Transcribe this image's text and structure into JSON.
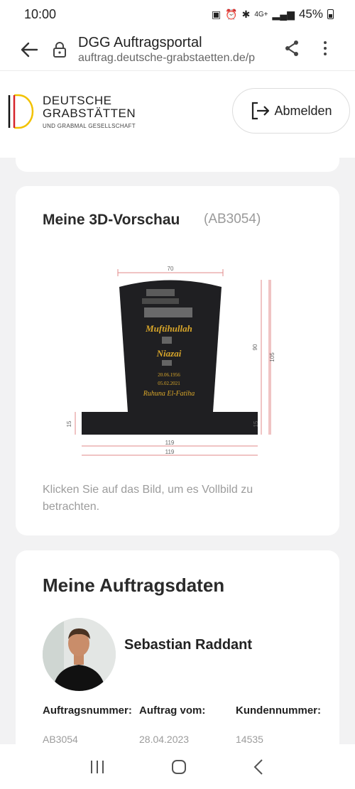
{
  "status": {
    "time": "10:00",
    "battery": "45%",
    "network": "4G+"
  },
  "browser": {
    "title": "DGG Auftragsportal",
    "url": "auftrag.deutsche-grabstaetten.de/p"
  },
  "brand": {
    "line1": "DEUTSCHE",
    "line2": "GRABSTÄTTEN",
    "sub": "UND GRABMAL GESELLSCHAFT"
  },
  "header": {
    "logout_label": "Abmelden"
  },
  "preview": {
    "title": "Meine 3D-Vorschau",
    "code": "(AB3054)",
    "hint": "Klicken Sie auf das Bild, um es Vollbild zu betrachten.",
    "inscription": {
      "name1": "Muftihullah",
      "name2": "Niazai",
      "born": "20.06.1956",
      "died": "05.02.2021",
      "epitaph": "Ruhuna El-Fatiha"
    },
    "dimensions": {
      "top_width": "70",
      "height_inner": "90",
      "height_total": "105",
      "base_height_left": "15",
      "base_height_right": "15",
      "base_width_1": "119",
      "base_width_2": "119"
    }
  },
  "order": {
    "title": "Meine Auftragsdaten",
    "customer_name": "Sebastian Raddant",
    "labels": {
      "number": "Auftragsnummer:",
      "date": "Auftrag vom:",
      "customer": "Kundennummer:"
    },
    "values": {
      "number": "AB3054",
      "date": "28.04.2023",
      "customer": "14535"
    }
  },
  "colors": {
    "accent_gold": "#d8a62a",
    "logo_yellow": "#f2c200",
    "logo_red": "#d6252b",
    "stone": "#1f1f22"
  }
}
